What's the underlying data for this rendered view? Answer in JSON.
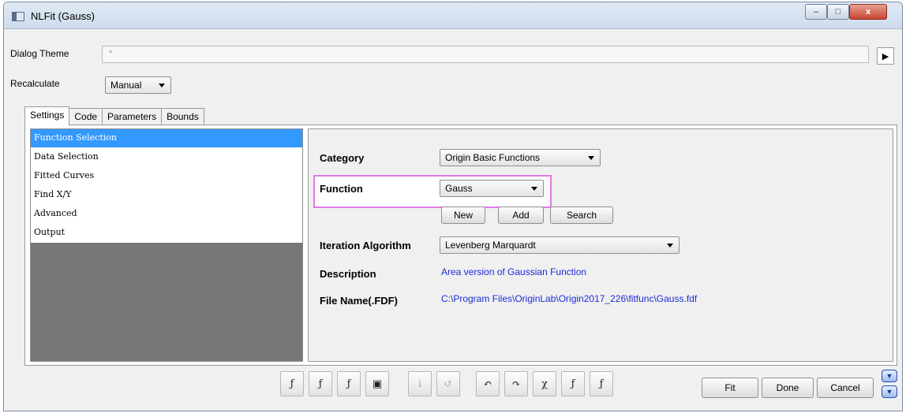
{
  "window": {
    "title": "NLFit (Gauss)"
  },
  "caption": {
    "minimize": "–",
    "maximize": "□",
    "close": "x"
  },
  "dialog_theme": {
    "label": "Dialog Theme",
    "value": "*",
    "arrow": "▶"
  },
  "recalculate": {
    "label": "Recalculate",
    "value": "Manual"
  },
  "tabs": [
    {
      "label": "Settings",
      "active": true
    },
    {
      "label": "Code"
    },
    {
      "label": "Parameters"
    },
    {
      "label": "Bounds"
    }
  ],
  "nav": {
    "items": [
      {
        "label": "Function Selection",
        "selected": true
      },
      {
        "label": "Data Selection"
      },
      {
        "label": "Fitted Curves"
      },
      {
        "label": "Find X/Y"
      },
      {
        "label": "Advanced"
      },
      {
        "label": "Output"
      }
    ]
  },
  "settings": {
    "category": {
      "label": "Category",
      "value": "Origin Basic Functions"
    },
    "function": {
      "label": "Function",
      "value": "Gauss"
    },
    "buttons": {
      "new": "New",
      "add": "Add",
      "search": "Search"
    },
    "iteration": {
      "label": "Iteration Algorithm",
      "value": "Levenberg Marquardt"
    },
    "description": {
      "label": "Description",
      "value": "Area version of Gaussian Function"
    },
    "file_name": {
      "label": "File Name(.FDF)",
      "value": "C:\\Program Files\\OriginLab\\Origin2017_226\\fitfunc\\Gauss.fdf"
    }
  },
  "toolbar": {
    "icons": [
      {
        "name": "fit-function-icon",
        "glyph": "ƒ"
      },
      {
        "name": "f-sum-icon",
        "glyph": "ƒ"
      },
      {
        "name": "formula-icon",
        "glyph": "ƒ"
      },
      {
        "name": "save-icon",
        "glyph": "▣"
      },
      {
        "name": "sort-icon",
        "glyph": "↓"
      },
      {
        "name": "reset-icon",
        "glyph": "↺"
      },
      {
        "name": "undo-icon",
        "glyph": "↶"
      },
      {
        "name": "one-iteration-icon",
        "glyph": "↷"
      },
      {
        "name": "chi-square-icon",
        "glyph": "χ"
      },
      {
        "name": "fit-until-converged-icon",
        "glyph": "ƒ"
      },
      {
        "name": "fit-all-icon",
        "glyph": "ƒ"
      }
    ]
  },
  "actions": {
    "fit": "Fit",
    "done": "Done",
    "cancel": "Cancel"
  },
  "colors": {
    "selection": "#3399ff",
    "link": "#1a2cd6",
    "highlight": "#e07ae6"
  }
}
